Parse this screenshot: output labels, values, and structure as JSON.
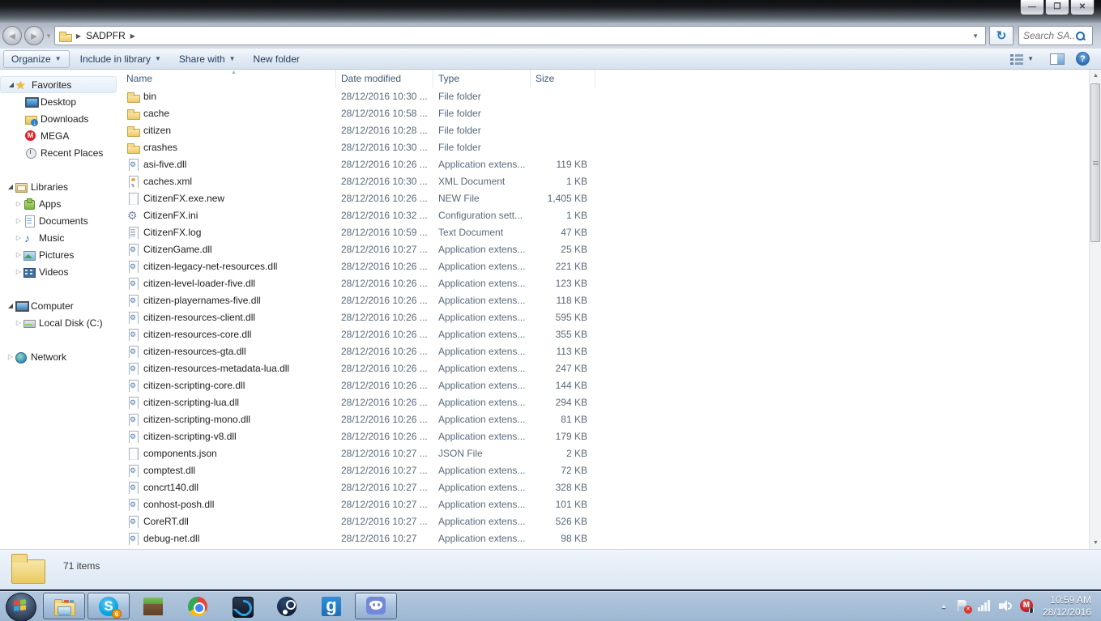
{
  "window": {
    "min_label": "—",
    "max_label": "❐",
    "close_label": "✕",
    "back_glyph": "◄",
    "forward_glyph": "►",
    "breadcrumb_folder": "SADPFR",
    "refresh_glyph": "↻",
    "search_placeholder": "Search SA..."
  },
  "toolbar": {
    "buttons": [
      {
        "label": "Organize",
        "dropdown": true,
        "bordered": true
      },
      {
        "label": "Include in library",
        "dropdown": true,
        "bordered": false
      },
      {
        "label": "Share with",
        "dropdown": true,
        "bordered": false
      },
      {
        "label": "New folder",
        "dropdown": false,
        "bordered": false
      }
    ],
    "help_glyph": "?"
  },
  "sidebar": {
    "sections": [
      {
        "label": "Favorites",
        "icon": "i-star",
        "expanded": true,
        "highlight": true,
        "items": [
          {
            "label": "Desktop",
            "icon": "i-monitor",
            "expandable": false
          },
          {
            "label": "Downloads",
            "icon": "i-folder-dl",
            "expandable": false
          },
          {
            "label": "MEGA",
            "icon": "i-mega",
            "expandable": false
          },
          {
            "label": "Recent Places",
            "icon": "i-clock",
            "expandable": false
          }
        ]
      },
      {
        "label": "Libraries",
        "icon": "i-lib",
        "expanded": true,
        "highlight": false,
        "items": [
          {
            "label": "Apps",
            "icon": "i-apps",
            "expandable": true
          },
          {
            "label": "Documents",
            "icon": "i-doc",
            "expandable": true
          },
          {
            "label": "Music",
            "icon": "i-music",
            "expandable": true
          },
          {
            "label": "Pictures",
            "icon": "i-pic",
            "expandable": true
          },
          {
            "label": "Videos",
            "icon": "i-video",
            "expandable": true
          }
        ]
      },
      {
        "label": "Computer",
        "icon": "i-computer",
        "expanded": true,
        "highlight": false,
        "items": [
          {
            "label": "Local Disk (C:)",
            "icon": "i-disk",
            "expandable": true
          }
        ]
      },
      {
        "label": "Network",
        "icon": "i-network",
        "expanded": false,
        "highlight": false,
        "items": []
      }
    ]
  },
  "filelist": {
    "columns": [
      "Name",
      "Date modified",
      "Type",
      "Size"
    ],
    "rows": [
      {
        "name": "bin",
        "date": "28/12/2016 10:30 ...",
        "type": "File folder",
        "size": "",
        "icon": "fi-folder"
      },
      {
        "name": "cache",
        "date": "28/12/2016 10:58 ...",
        "type": "File folder",
        "size": "",
        "icon": "fi-folder"
      },
      {
        "name": "citizen",
        "date": "28/12/2016 10:28 ...",
        "type": "File folder",
        "size": "",
        "icon": "fi-folder"
      },
      {
        "name": "crashes",
        "date": "28/12/2016 10:30 ...",
        "type": "File folder",
        "size": "",
        "icon": "fi-folder"
      },
      {
        "name": "asi-five.dll",
        "date": "28/12/2016 10:26 ...",
        "type": "Application extens...",
        "size": "119 KB",
        "icon": "fi-dll"
      },
      {
        "name": "caches.xml",
        "date": "28/12/2016 10:30 ...",
        "type": "XML Document",
        "size": "1 KB",
        "icon": "fi-xml"
      },
      {
        "name": "CitizenFX.exe.new",
        "date": "28/12/2016 10:26 ...",
        "type": "NEW File",
        "size": "1,405 KB",
        "icon": "fi-page"
      },
      {
        "name": "CitizenFX.ini",
        "date": "28/12/2016 10:32 ...",
        "type": "Configuration sett...",
        "size": "1 KB",
        "icon": "fi-gear"
      },
      {
        "name": "CitizenFX.log",
        "date": "28/12/2016 10:59 ...",
        "type": "Text Document",
        "size": "47 KB",
        "icon": "fi-log"
      },
      {
        "name": "CitizenGame.dll",
        "date": "28/12/2016 10:27 ...",
        "type": "Application extens...",
        "size": "25 KB",
        "icon": "fi-dll"
      },
      {
        "name": "citizen-legacy-net-resources.dll",
        "date": "28/12/2016 10:26 ...",
        "type": "Application extens...",
        "size": "221 KB",
        "icon": "fi-dll"
      },
      {
        "name": "citizen-level-loader-five.dll",
        "date": "28/12/2016 10:26 ...",
        "type": "Application extens...",
        "size": "123 KB",
        "icon": "fi-dll"
      },
      {
        "name": "citizen-playernames-five.dll",
        "date": "28/12/2016 10:26 ...",
        "type": "Application extens...",
        "size": "118 KB",
        "icon": "fi-dll"
      },
      {
        "name": "citizen-resources-client.dll",
        "date": "28/12/2016 10:26 ...",
        "type": "Application extens...",
        "size": "595 KB",
        "icon": "fi-dll"
      },
      {
        "name": "citizen-resources-core.dll",
        "date": "28/12/2016 10:26 ...",
        "type": "Application extens...",
        "size": "355 KB",
        "icon": "fi-dll"
      },
      {
        "name": "citizen-resources-gta.dll",
        "date": "28/12/2016 10:26 ...",
        "type": "Application extens...",
        "size": "113 KB",
        "icon": "fi-dll"
      },
      {
        "name": "citizen-resources-metadata-lua.dll",
        "date": "28/12/2016 10:26 ...",
        "type": "Application extens...",
        "size": "247 KB",
        "icon": "fi-dll"
      },
      {
        "name": "citizen-scripting-core.dll",
        "date": "28/12/2016 10:26 ...",
        "type": "Application extens...",
        "size": "144 KB",
        "icon": "fi-dll"
      },
      {
        "name": "citizen-scripting-lua.dll",
        "date": "28/12/2016 10:26 ...",
        "type": "Application extens...",
        "size": "294 KB",
        "icon": "fi-dll"
      },
      {
        "name": "citizen-scripting-mono.dll",
        "date": "28/12/2016 10:26 ...",
        "type": "Application extens...",
        "size": "81 KB",
        "icon": "fi-dll"
      },
      {
        "name": "citizen-scripting-v8.dll",
        "date": "28/12/2016 10:26 ...",
        "type": "Application extens...",
        "size": "179 KB",
        "icon": "fi-dll"
      },
      {
        "name": "components.json",
        "date": "28/12/2016 10:27 ...",
        "type": "JSON File",
        "size": "2 KB",
        "icon": "fi-page"
      },
      {
        "name": "comptest.dll",
        "date": "28/12/2016 10:27 ...",
        "type": "Application extens...",
        "size": "72 KB",
        "icon": "fi-dll"
      },
      {
        "name": "concrt140.dll",
        "date": "28/12/2016 10:27 ...",
        "type": "Application extens...",
        "size": "328 KB",
        "icon": "fi-dll"
      },
      {
        "name": "conhost-posh.dll",
        "date": "28/12/2016 10:27 ...",
        "type": "Application extens...",
        "size": "101 KB",
        "icon": "fi-dll"
      },
      {
        "name": "CoreRT.dll",
        "date": "28/12/2016 10:27 ...",
        "type": "Application extens...",
        "size": "526 KB",
        "icon": "fi-dll"
      },
      {
        "name": "debug-net.dll",
        "date": "28/12/2016 10:27",
        "type": "Application extens...",
        "size": "98 KB",
        "icon": "fi-dll"
      }
    ]
  },
  "statusbar": {
    "item_count": "71 items"
  },
  "taskbar": {
    "apps": [
      {
        "name": "explorer",
        "icon": "t-explorer",
        "running": true,
        "badge": ""
      },
      {
        "name": "skype",
        "icon": "t-skype",
        "running": true,
        "badge": "6"
      },
      {
        "name": "minecraft",
        "icon": "t-mc",
        "running": false,
        "badge": ""
      },
      {
        "name": "chrome",
        "icon": "t-chrome",
        "running": false,
        "badge": ""
      },
      {
        "name": "battlenet",
        "icon": "t-bnet",
        "running": false,
        "badge": ""
      },
      {
        "name": "steam",
        "icon": "t-steam",
        "running": false,
        "badge": ""
      },
      {
        "name": "gmod",
        "icon": "t-gmod",
        "running": false,
        "badge": ""
      },
      {
        "name": "discord",
        "icon": "t-discord",
        "running": true,
        "badge": ""
      }
    ],
    "tray": {
      "time": "10:59 AM",
      "date": "28/12/2016"
    }
  }
}
